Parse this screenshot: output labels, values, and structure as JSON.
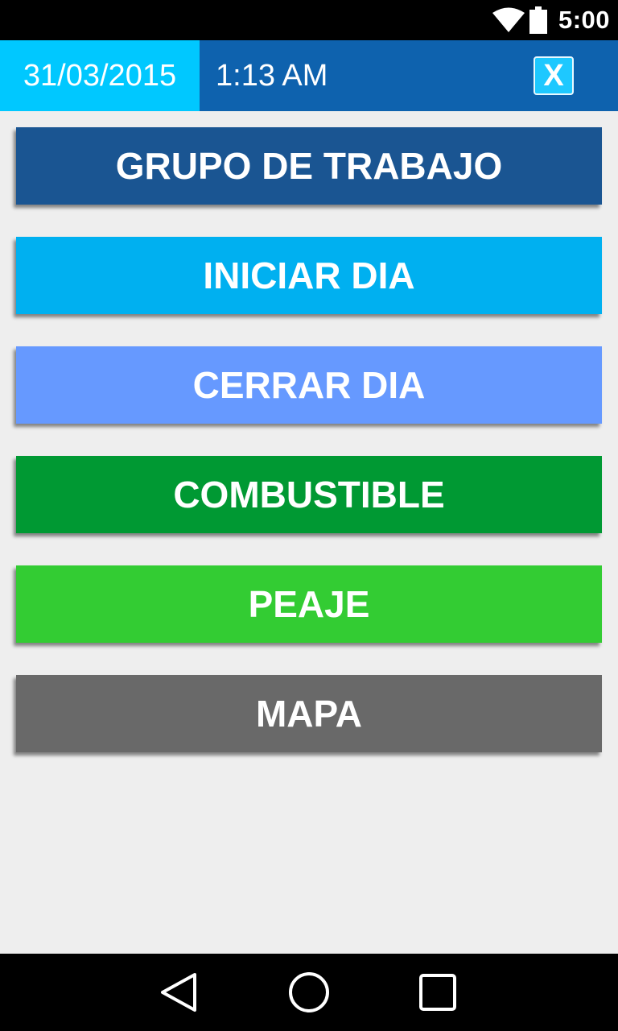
{
  "status_bar": {
    "time": "5:00",
    "icons": [
      "wifi-icon",
      "battery-icon"
    ]
  },
  "header": {
    "date": "31/03/2015",
    "time": "1:13 AM",
    "close_label": "X",
    "colors": {
      "header_bg": "#0e62ae",
      "date_bg": "#00c8ff",
      "close_bg": "#1ec8ff"
    }
  },
  "menu": {
    "items": [
      {
        "label": "GRUPO DE TRABAJO",
        "color": "#1a5592"
      },
      {
        "label": "INICIAR DIA",
        "color": "#00b0f0"
      },
      {
        "label": "CERRAR DIA",
        "color": "#6699ff"
      },
      {
        "label": "COMBUSTIBLE",
        "color": "#009933"
      },
      {
        "label": "PEAJE",
        "color": "#33cc33"
      },
      {
        "label": "MAPA",
        "color": "#696969"
      }
    ]
  },
  "nav_bar": {
    "icons": [
      "back-icon",
      "home-icon",
      "recents-icon"
    ]
  }
}
